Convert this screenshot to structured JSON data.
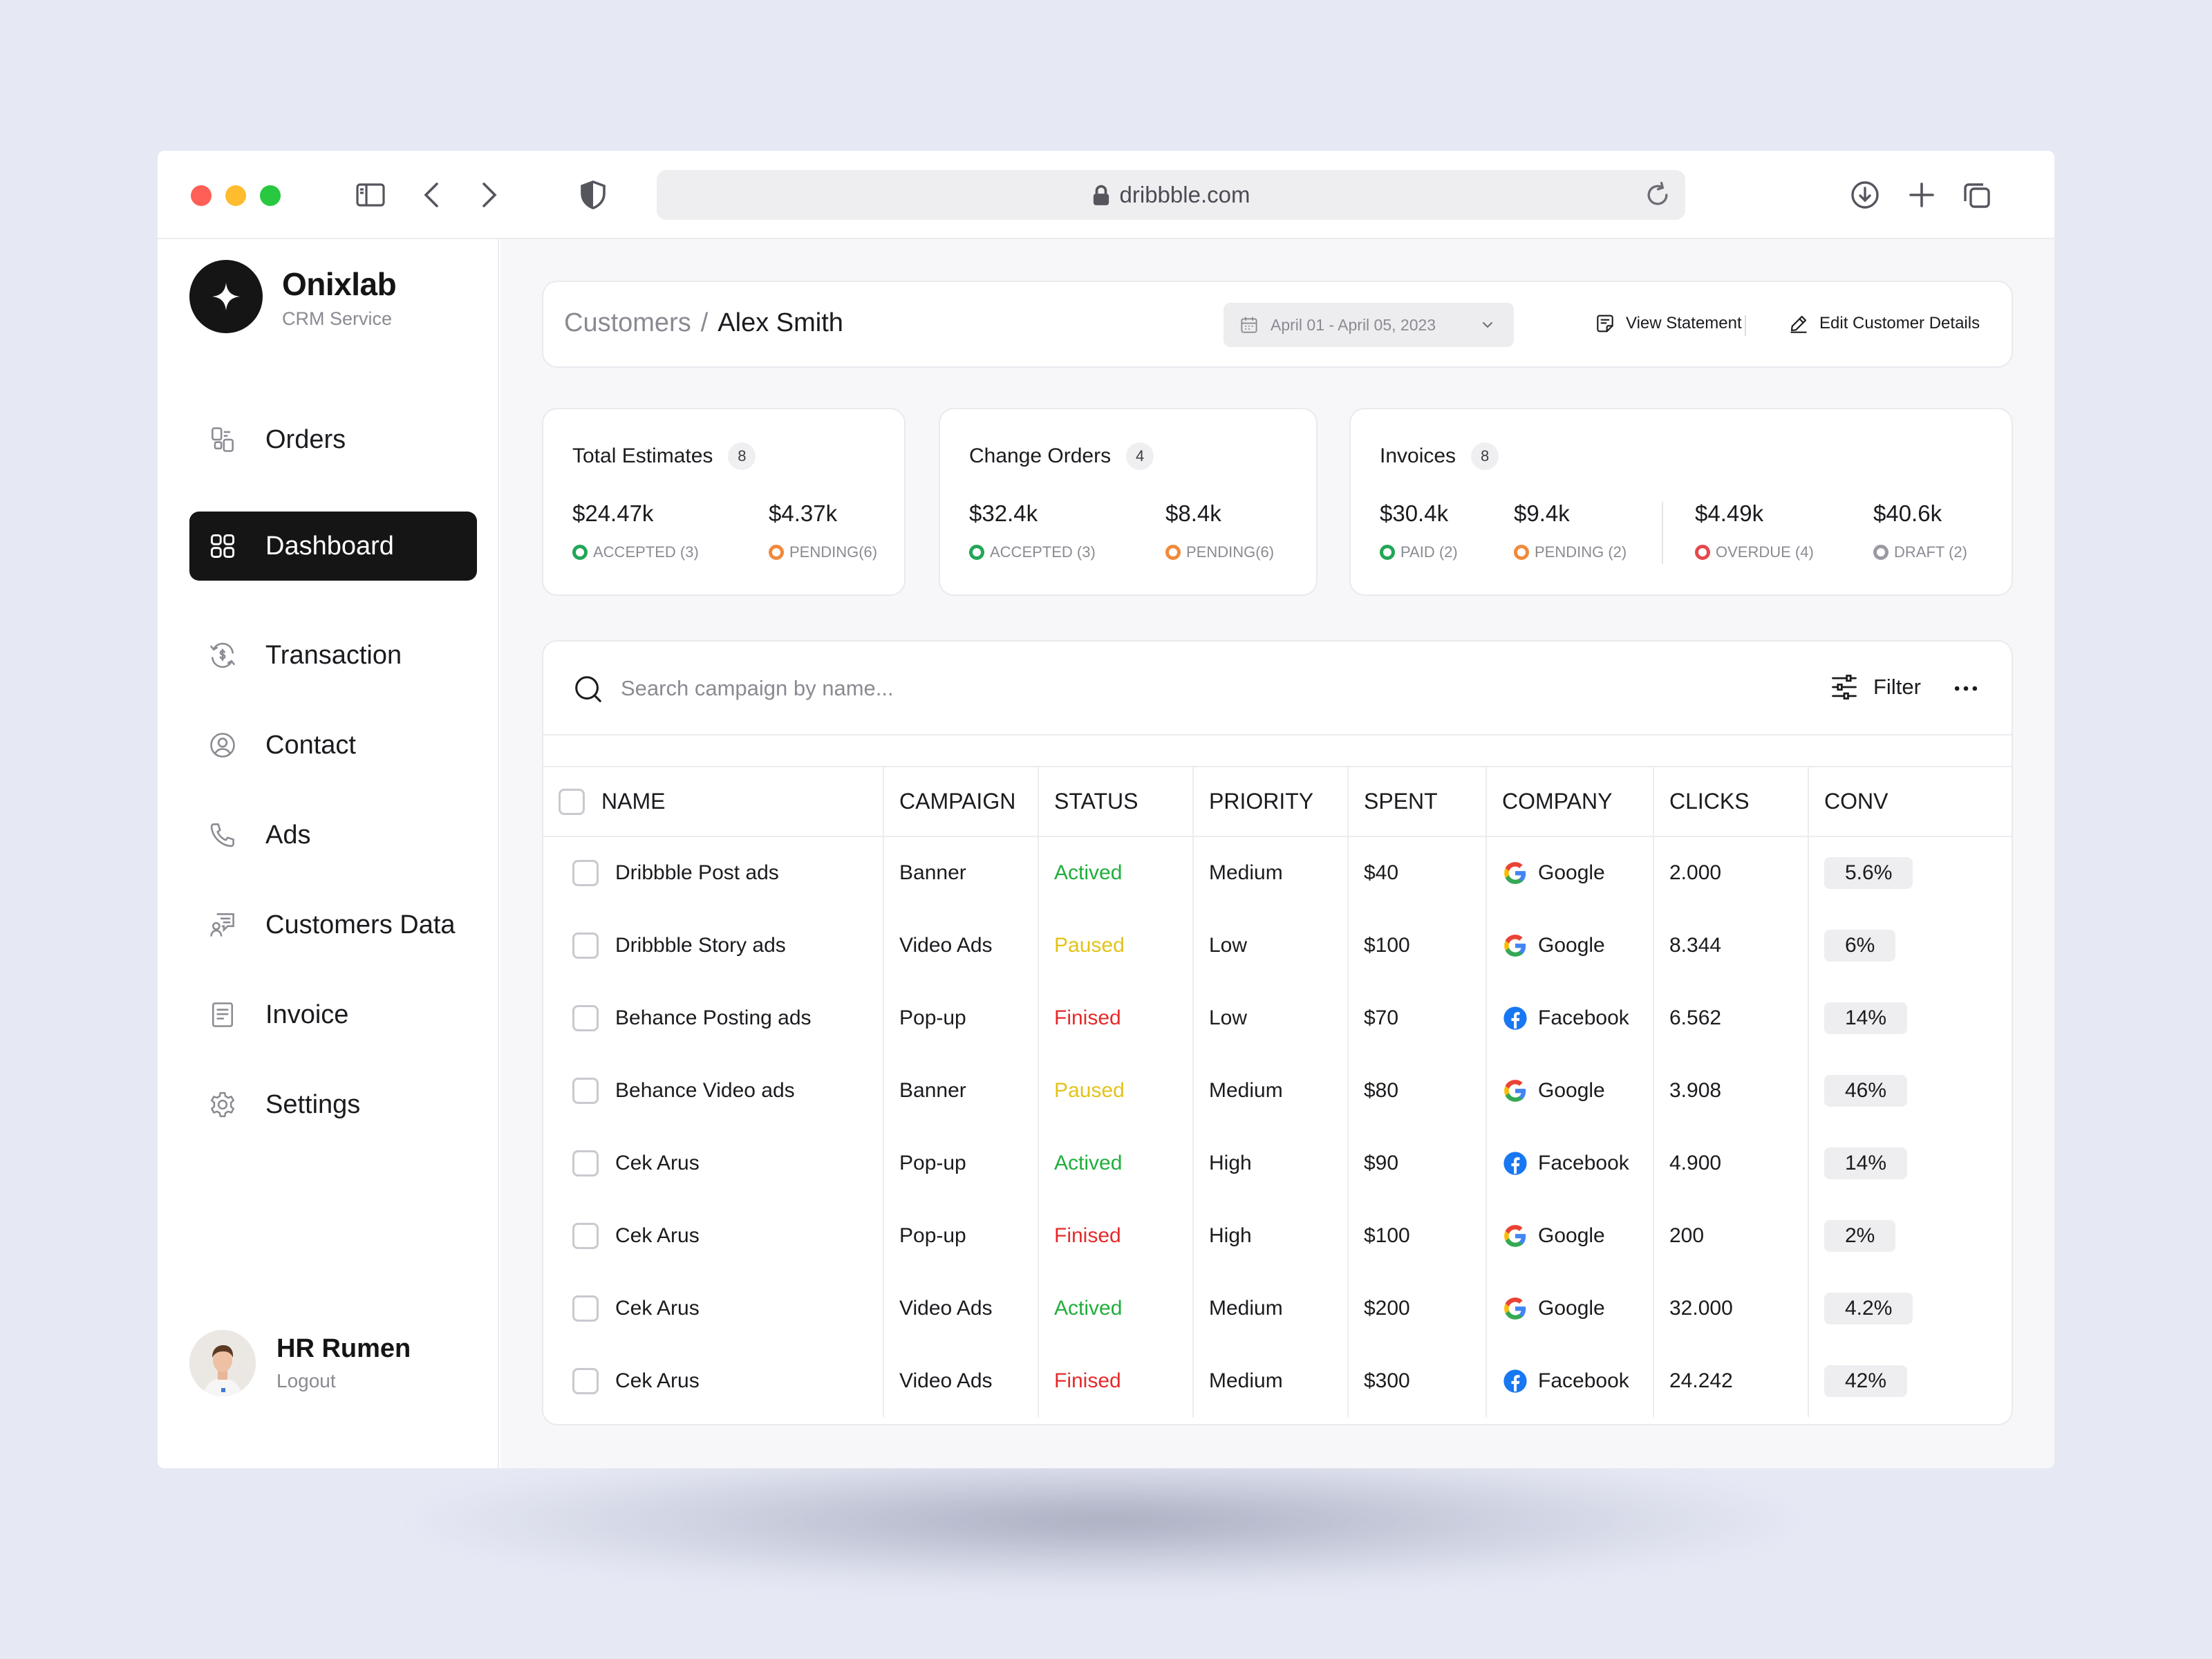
{
  "browser": {
    "url": "dribbble.com"
  },
  "brand": {
    "name": "Onixlab",
    "subtitle": "CRM Service"
  },
  "sidebar": {
    "items": [
      {
        "label": "Orders",
        "icon": "orders-icon"
      },
      {
        "label": "Dashboard",
        "icon": "dashboard-grid-icon",
        "active": true
      },
      {
        "label": "Transaction",
        "icon": "transaction-icon"
      },
      {
        "label": "Contact",
        "icon": "contact-icon"
      },
      {
        "label": "Ads",
        "icon": "phone-icon"
      },
      {
        "label": "Customers Data",
        "icon": "customers-data-icon"
      },
      {
        "label": "Invoice",
        "icon": "invoice-icon"
      },
      {
        "label": "Settings",
        "icon": "gear-icon"
      }
    ]
  },
  "user": {
    "name": "HR Rumen",
    "logout": "Logout"
  },
  "header": {
    "breadcrumb_parent": "Customers",
    "breadcrumb_sep": "/",
    "breadcrumb_current": "Alex Smith",
    "date_range": "April 01 - April 05, 2023",
    "view_statement": "View Statement",
    "edit_details": "Edit Customer Details"
  },
  "stats": {
    "estimates": {
      "title": "Total Estimates",
      "count": "8",
      "a_value": "$24.47k",
      "a_label": "ACCEPTED (3)",
      "b_value": "$4.37k",
      "b_label": "PENDING(6)"
    },
    "change_orders": {
      "title": "Change Orders",
      "count": "4",
      "a_value": "$32.4k",
      "a_label": "ACCEPTED (3)",
      "b_value": "$8.4k",
      "b_label": "PENDING(6)"
    },
    "invoices": {
      "title": "Invoices",
      "count": "8",
      "a_value": "$30.4k",
      "a_label": "PAID (2)",
      "b_value": "$9.4k",
      "b_label": "PENDING (2)",
      "c_value": "$4.49k",
      "c_label": "OVERDUE (4)",
      "d_value": "$40.6k",
      "d_label": "DRAFT (2)"
    }
  },
  "status_colors": {
    "accepted": "#22a658",
    "pending": "#f08a3c",
    "overdue": "#e5484d",
    "draft": "#9a9aa2"
  },
  "table": {
    "search_placeholder": "Search campaign by name...",
    "filter_label": "Filter",
    "columns": [
      "NAME",
      "CAMPAIGN",
      "STATUS",
      "PRIORITY",
      "SPENT",
      "COMPANY",
      "CLICKS",
      "CONV"
    ],
    "rows": [
      {
        "name": "Dribbble Post ads",
        "campaign": "Banner",
        "status": "Actived",
        "priority": "Medium",
        "spent": "$40",
        "company": "Google",
        "clicks": "2.000",
        "conv": "5.6%"
      },
      {
        "name": "Dribbble Story ads",
        "campaign": "Video Ads",
        "status": "Paused",
        "priority": "Low",
        "spent": "$100",
        "company": "Google",
        "clicks": "8.344",
        "conv": "6%"
      },
      {
        "name": "Behance Posting ads",
        "campaign": "Pop-up",
        "status": "Finised",
        "priority": "Low",
        "spent": "$70",
        "company": "Facebook",
        "clicks": "6.562",
        "conv": "14%"
      },
      {
        "name": "Behance Video ads",
        "campaign": "Banner",
        "status": "Paused",
        "priority": "Medium",
        "spent": "$80",
        "company": "Google",
        "clicks": "3.908",
        "conv": "46%"
      },
      {
        "name": "Cek Arus",
        "campaign": "Pop-up",
        "status": "Actived",
        "priority": "High",
        "spent": "$90",
        "company": "Facebook",
        "clicks": "4.900",
        "conv": "14%"
      },
      {
        "name": "Cek Arus",
        "campaign": "Pop-up",
        "status": "Finised",
        "priority": "High",
        "spent": "$100",
        "company": "Google",
        "clicks": "200",
        "conv": "2%"
      },
      {
        "name": "Cek Arus",
        "campaign": "Video Ads",
        "status": "Actived",
        "priority": "Medium",
        "spent": "$200",
        "company": "Google",
        "clicks": "32.000",
        "conv": "4.2%"
      },
      {
        "name": "Cek Arus",
        "campaign": "Video Ads",
        "status": "Finised",
        "priority": "Medium",
        "spent": "$300",
        "company": "Facebook",
        "clicks": "24.242",
        "conv": "42%"
      }
    ]
  }
}
